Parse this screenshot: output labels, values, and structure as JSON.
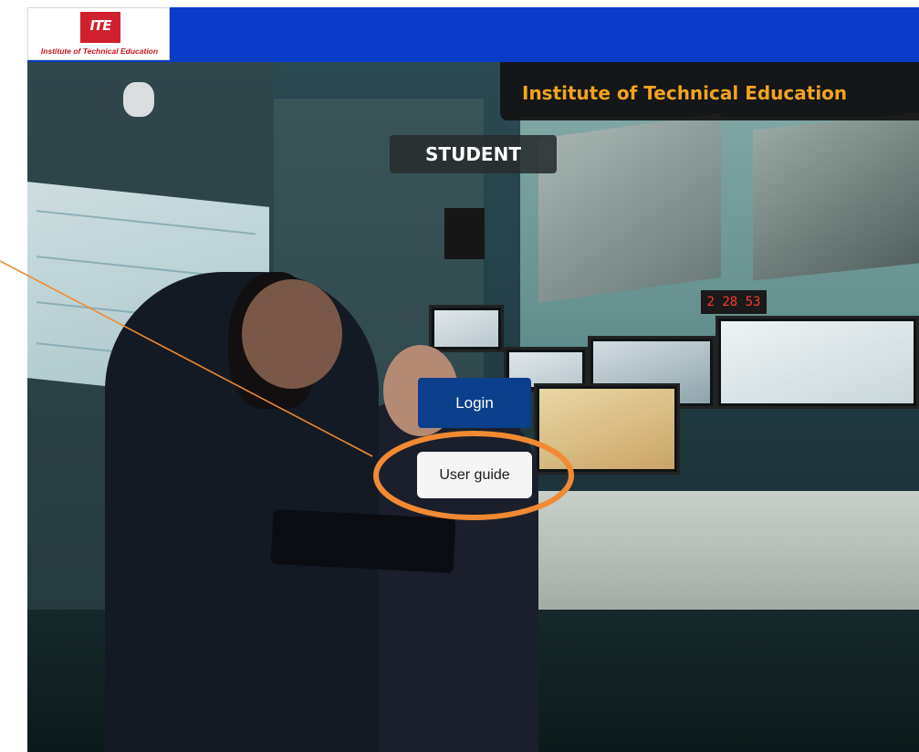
{
  "header": {
    "logo_mark": "ITE",
    "logo_subtitle": "Institute of Technical Education",
    "brand_color": "#0a3bc7",
    "logo_color": "#d0202e"
  },
  "hero": {
    "institution_title": "Institute of Technical Education",
    "role_label": "STUDENT",
    "clock_display": "2 28 53",
    "title_color": "#f2a41e"
  },
  "actions": {
    "login_label": "Login",
    "user_guide_label": "User guide",
    "login_color": "#0b3f8c"
  },
  "annotation": {
    "highlight_color": "#f08a33",
    "highlight_target": "User guide"
  }
}
